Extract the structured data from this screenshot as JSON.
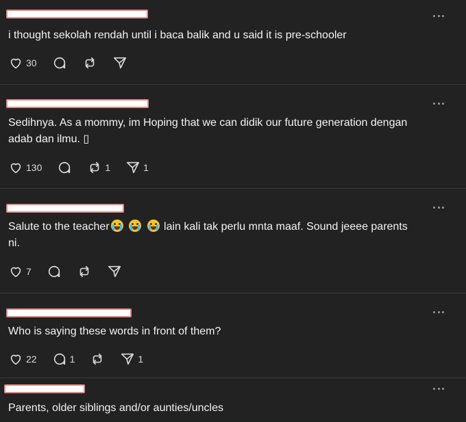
{
  "posts": [
    {
      "text": "i thought sekolah rendah until i baca balik and u said it is pre-schooler",
      "likes": "30",
      "replies": "",
      "reposts": "",
      "shares": ""
    },
    {
      "text": "Sedihnya. As a mommy, im Hoping that we can didik our future generation dengan adab dan ilmu. ▯",
      "likes": "130",
      "replies": "",
      "reposts": "1",
      "shares": "1"
    },
    {
      "text_before_emoji": "Salute to the teacher",
      "text_after_emoji": " lain kali tak perlu mnta maaf. Sound jeeee parents ni.",
      "emoji": "loudly-crying-face",
      "emoji_count": 3,
      "likes": "7",
      "replies": "",
      "reposts": "",
      "shares": ""
    },
    {
      "text": "Who is saying these words in front of them?",
      "likes": "22",
      "replies": "1",
      "reposts": "",
      "shares": "1"
    },
    {
      "text": "Parents, older siblings and/or aunties/uncles"
    }
  ],
  "icons": {
    "like": "heart-icon",
    "reply": "comment-icon",
    "repost": "repost-icon",
    "share": "send-icon",
    "more": "more-options-icon"
  },
  "colors": {
    "background": "#222222",
    "divider": "#3a3a3a",
    "text": "#f3f3f3",
    "redaction_border": "#e58a8a",
    "redaction_fill": "#ffffff"
  }
}
